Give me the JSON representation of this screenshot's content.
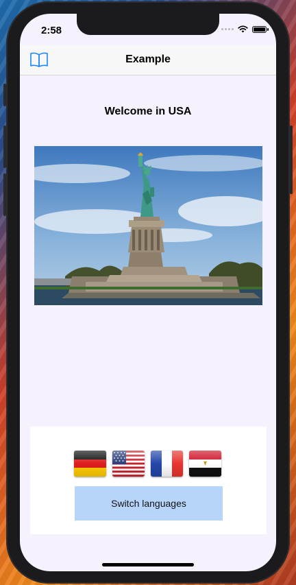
{
  "status_bar": {
    "time": "2:58"
  },
  "navbar": {
    "title": "Example",
    "left_icon": "book-icon"
  },
  "main": {
    "welcome_text": "Welcome in USA",
    "photo": {
      "subject": "statue-of-liberty"
    }
  },
  "language_panel": {
    "flags": [
      {
        "country": "germany",
        "icon": "flag-germany-icon"
      },
      {
        "country": "usa",
        "icon": "flag-usa-icon"
      },
      {
        "country": "france",
        "icon": "flag-france-icon"
      },
      {
        "country": "egypt",
        "icon": "flag-egypt-icon"
      }
    ],
    "switch_label": "Switch languages"
  },
  "colors": {
    "accent": "#1a84ff",
    "button_bg": "#b7d5fb",
    "screen_bg": "#f5f1fd"
  }
}
